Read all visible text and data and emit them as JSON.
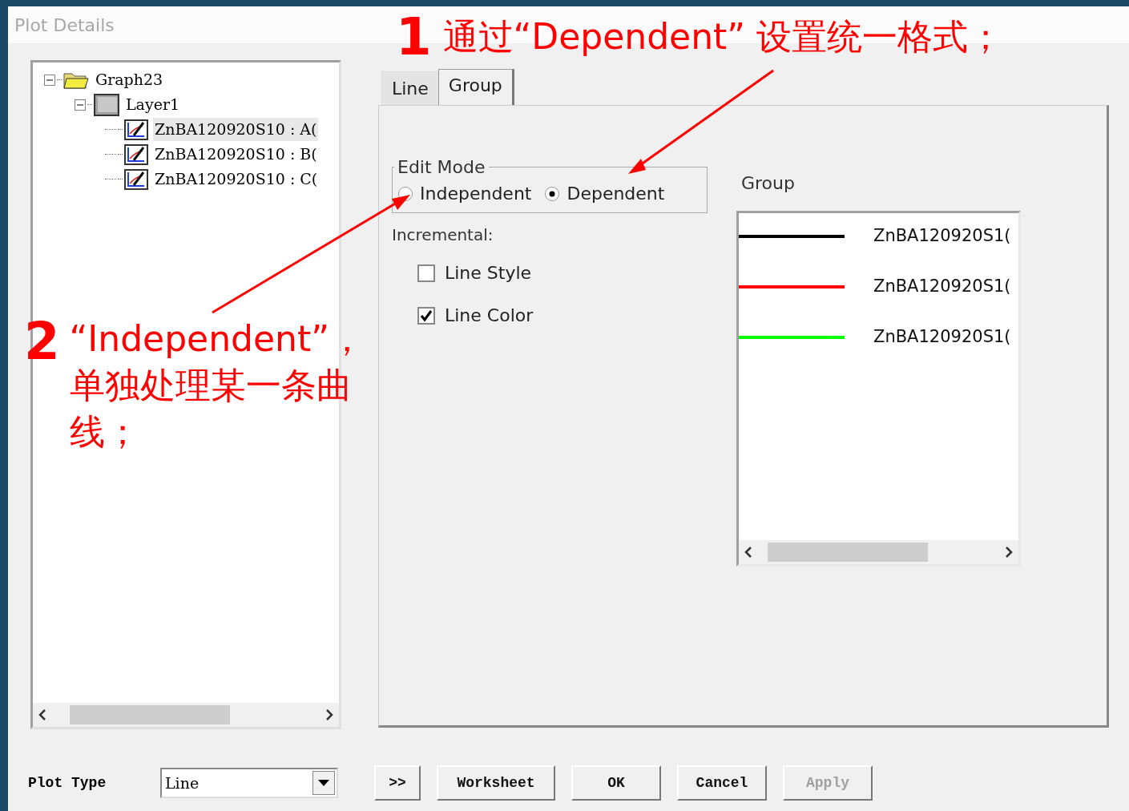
{
  "window": {
    "title": "Plot Details"
  },
  "tree": [
    {
      "label": "Graph23",
      "kind": "graph",
      "expanded": true,
      "children": [
        {
          "label": "Layer1",
          "kind": "layer",
          "expanded": true,
          "children": [
            {
              "label": "ZnBA120920S10 : A(",
              "kind": "plot",
              "selected": true
            },
            {
              "label": "ZnBA120920S10 : B(",
              "kind": "plot",
              "selected": false
            },
            {
              "label": "ZnBA120920S10 : C(",
              "kind": "plot",
              "selected": false
            }
          ]
        }
      ]
    }
  ],
  "tabs": [
    {
      "label": "Line",
      "selected": false
    },
    {
      "label": "Group",
      "selected": true
    }
  ],
  "edit_mode": {
    "title": "Edit Mode",
    "options": [
      {
        "label": "Independent",
        "selected": false
      },
      {
        "label": "Dependent",
        "selected": true
      }
    ]
  },
  "incremental": {
    "label": "Incremental:",
    "options": [
      {
        "label": "Line Style",
        "checked": false
      },
      {
        "label": "Line Color",
        "checked": true
      }
    ]
  },
  "group": {
    "label": "Group",
    "items": [
      {
        "name": "ZnBA120920S1(",
        "color": "#000000"
      },
      {
        "name": "ZnBA120920S1(",
        "color": "#ff0000"
      },
      {
        "name": "ZnBA120920S1(",
        "color": "#00ff00"
      }
    ]
  },
  "bottom": {
    "plot_type_label": "Plot Type",
    "plot_type": "Line",
    "buttons": [
      {
        "label": ">>",
        "disabled": false
      },
      {
        "label": "Worksheet",
        "disabled": false
      },
      {
        "label": "OK",
        "disabled": false
      },
      {
        "label": "Cancel",
        "disabled": false
      },
      {
        "label": "Apply",
        "disabled": true
      }
    ]
  },
  "annotations": [
    {
      "number": "1",
      "text": "通过“Dependent” 设置统一格式；"
    },
    {
      "number": "2",
      "text": "“Independent”，单独处理某一条曲线；"
    }
  ]
}
